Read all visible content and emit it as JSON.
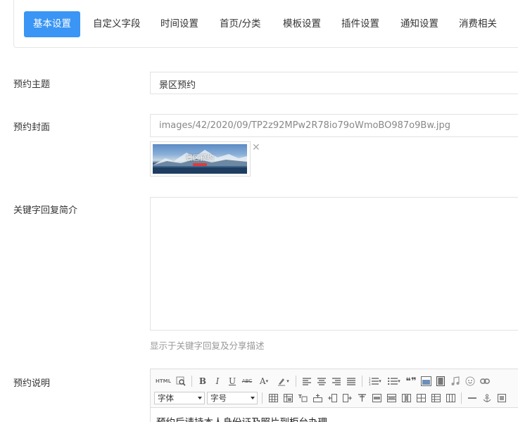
{
  "tabs": [
    {
      "label": "基本设置",
      "active": true
    },
    {
      "label": "自定义字段"
    },
    {
      "label": "时间设置"
    },
    {
      "label": "首页/分类"
    },
    {
      "label": "模板设置"
    },
    {
      "label": "插件设置"
    },
    {
      "label": "通知设置"
    },
    {
      "label": "消费相关"
    }
  ],
  "form": {
    "subject": {
      "label": "预约主题",
      "value": "景区预约"
    },
    "cover": {
      "label": "预约封面",
      "value": "images/42/2020/09/TP2z92MPw2R78io79oWmoBO987o9Bw.jpg",
      "thumb_caption": "景区预约",
      "remove_glyph": "✕"
    },
    "reply_intro": {
      "label": "关键字回复简介",
      "value": "",
      "hint": "显示于关键字回复及分享描述"
    },
    "description": {
      "label": "预约说明",
      "content": "预约后请持本人身份证及照片到柜台办理",
      "toolbar": {
        "html_label": "HTML",
        "bold": "B",
        "italic": "I",
        "underline": "U",
        "strike": "ABC",
        "font_color": "A",
        "font_select": "字体",
        "size_select": "字号",
        "quote": "❝❞"
      }
    }
  },
  "colors": {
    "accent": "#3a95f5",
    "border": "#e2e2e2",
    "hint": "#999999"
  }
}
